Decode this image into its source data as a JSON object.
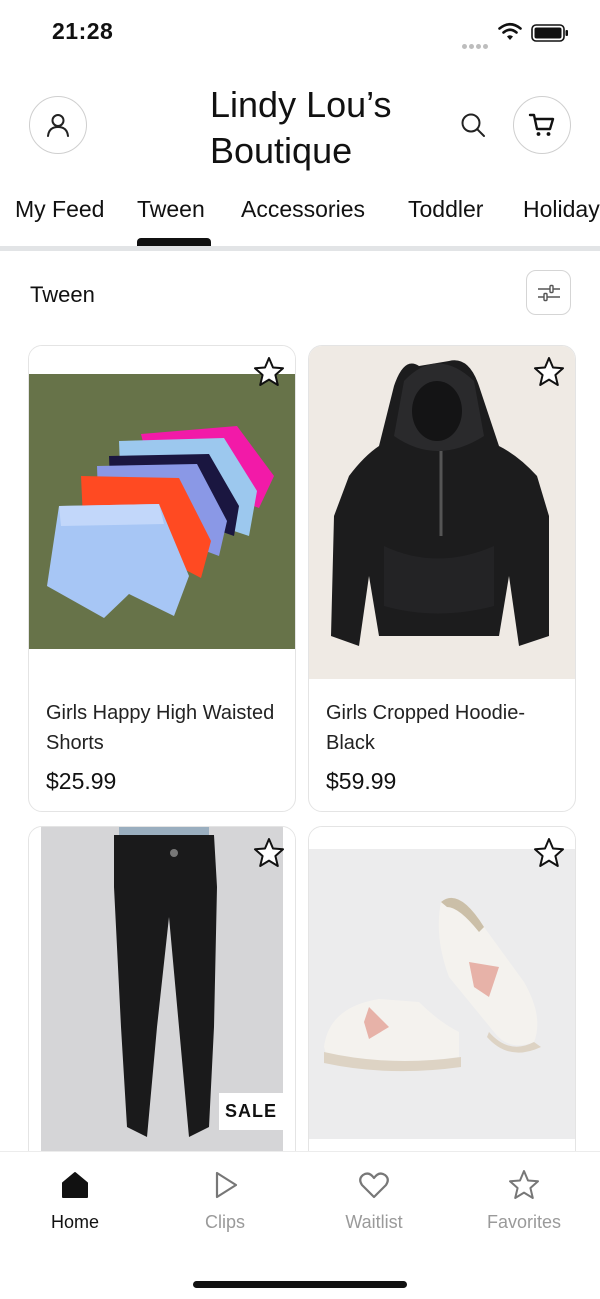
{
  "status_bar": {
    "time": "21:28"
  },
  "header": {
    "store_name": "Lindy Lou’s Boutique"
  },
  "tabs": [
    {
      "label": "My Feed"
    },
    {
      "label": "Tween"
    },
    {
      "label": "Accessories"
    },
    {
      "label": "Toddler"
    },
    {
      "label": "Holiday"
    }
  ],
  "active_tab": "Tween",
  "section": {
    "title": "Tween"
  },
  "products": [
    {
      "name": "Girls Happy High Waisted Shorts",
      "price": "$25.99",
      "image": "stacked-running-shorts"
    },
    {
      "name": "Girls Cropped Hoodie-Black",
      "price": "$59.99",
      "image": "black-cropped-hoodie"
    },
    {
      "name": "",
      "price": "",
      "image": "black-leggings",
      "badge": "SALE"
    },
    {
      "name": "",
      "price": "",
      "image": "star-sneakers"
    }
  ],
  "bottom_nav": [
    {
      "label": "Home",
      "icon": "home-icon",
      "active": true
    },
    {
      "label": "Clips",
      "icon": "play-icon",
      "active": false
    },
    {
      "label": "Waitlist",
      "icon": "heart-icon",
      "active": false
    },
    {
      "label": "Favorites",
      "icon": "star-icon",
      "active": false
    }
  ],
  "colors": {
    "text": "#111111",
    "muted": "#9a9a9a",
    "divider": "#e2e4e6",
    "card_border": "#e4e4e4"
  }
}
